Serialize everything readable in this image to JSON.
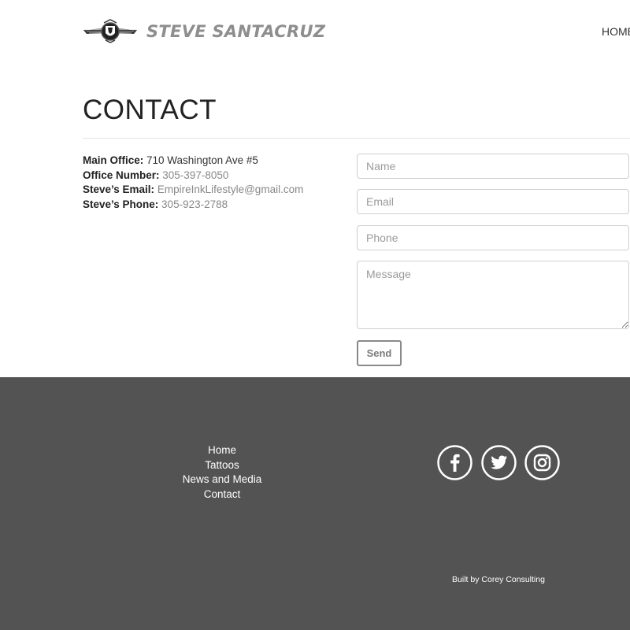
{
  "header": {
    "logo_text": "STEVE SANTACRUZ",
    "logo_icon": "winged-crest-icon",
    "nav": {
      "home": "HOME"
    }
  },
  "page": {
    "title": "CONTACT"
  },
  "contact_info": [
    {
      "label": "Main Office:",
      "value": "710 Washington Ave #5",
      "muted": false
    },
    {
      "label": "Office Number:",
      "value": "305-397-8050",
      "muted": true
    },
    {
      "label": "Steve’s Email:",
      "value": "EmpireInkLifestyle@gmail.com",
      "muted": true
    },
    {
      "label": "Steve’s Phone:",
      "value": "305-923-2788",
      "muted": true
    }
  ],
  "form": {
    "name_placeholder": "Name",
    "email_placeholder": "Email",
    "phone_placeholder": "Phone",
    "message_placeholder": "Message",
    "send_label": "Send"
  },
  "footer": {
    "nav": [
      "Home",
      "Tattoos",
      "News and Media",
      "Contact"
    ],
    "social": [
      "facebook-icon",
      "twitter-icon",
      "instagram-icon"
    ],
    "credit": "Built by Corey Consulting"
  },
  "colors": {
    "footer_bg": "#535353",
    "logo_text": "#8e8e8e",
    "muted_value": "#888888"
  }
}
